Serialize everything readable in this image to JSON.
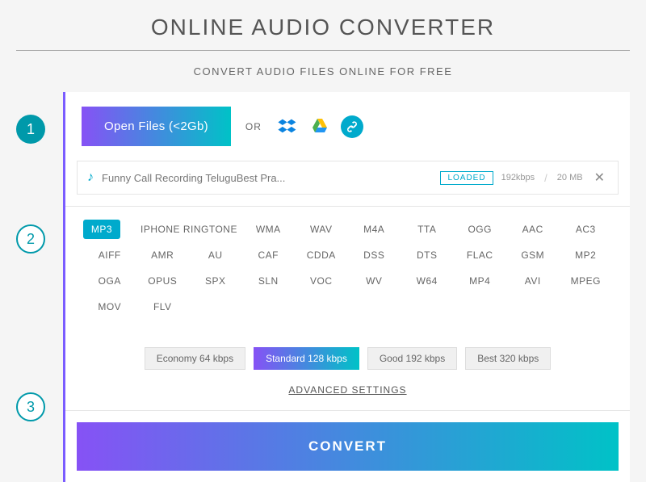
{
  "title": "ONLINE AUDIO CONVERTER",
  "subtitle": "CONVERT AUDIO FILES ONLINE FOR FREE",
  "steps": {
    "n1": "1",
    "n2": "2",
    "n3": "3"
  },
  "step1": {
    "open_label": "Open Files (<2Gb)",
    "or": "OR",
    "file": {
      "name": "Funny Call Recording TeluguBest Pra...",
      "status": "LOADED",
      "bitrate": "192kbps",
      "size": "20 MB"
    }
  },
  "step2": {
    "formats": [
      "MP3",
      "IPHONE RINGTONE",
      "WMA",
      "WAV",
      "M4A",
      "TTA",
      "OGG",
      "AAC",
      "AC3",
      "AIFF",
      "AMR",
      "AU",
      "CAF",
      "CDDA",
      "DSS",
      "DTS",
      "FLAC",
      "GSM",
      "MP2",
      "OGA",
      "OPUS",
      "SPX",
      "SLN",
      "VOC",
      "WV",
      "W64",
      "MP4",
      "AVI",
      "MPEG",
      "MOV",
      "FLV"
    ],
    "selected_format": "MP3",
    "qualities": [
      "Economy 64 kbps",
      "Standard 128 kbps",
      "Good 192 kbps",
      "Best 320 kbps"
    ],
    "selected_quality": "Standard 128 kbps",
    "advanced": "ADVANCED SETTINGS"
  },
  "step3": {
    "convert": "CONVERT"
  }
}
